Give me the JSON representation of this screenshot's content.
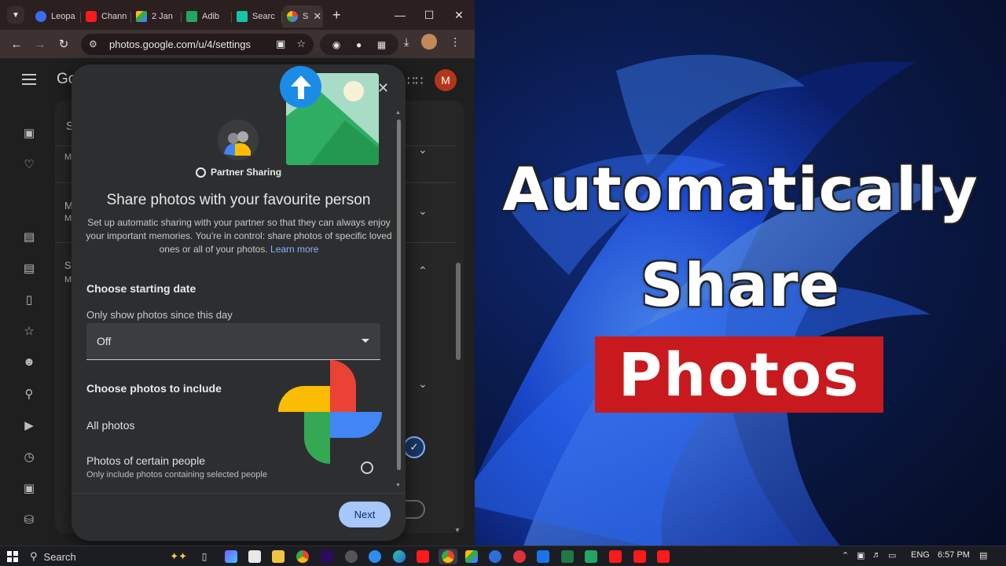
{
  "browser": {
    "tabs": [
      {
        "label": "Leopa",
        "color": "#3b6cf2"
      },
      {
        "label": "Chann",
        "color": "#ff1a1a"
      },
      {
        "label": "2 Jan",
        "color": "#34a853"
      },
      {
        "label": "Adib",
        "color": "#22a565"
      },
      {
        "label": "Searc",
        "color": "#19c3a6"
      },
      {
        "label": "S",
        "color": "#fbbc04"
      }
    ],
    "new_tab": "+",
    "url": "photos.google.com/u/4/settings"
  },
  "photos_page": {
    "logo_partial": "Goo",
    "avatar_letter": "M",
    "panel_letters": [
      "S",
      "M",
      "M",
      "M",
      "S",
      "M"
    ]
  },
  "dialog": {
    "badge": "Partner Sharing",
    "title": "Share photos with your favourite person",
    "description": "Set up automatic sharing with your partner so that they can always enjoy your important memories. You're in control: share photos of specific loved ones or all of your photos.",
    "learn_more": "Learn more",
    "starting_date": {
      "heading": "Choose starting date",
      "subheading": "Only show photos since this day",
      "selected": "Off"
    },
    "include": {
      "heading": "Choose photos to include",
      "option_all": "All photos",
      "option_people": "Photos of certain people",
      "option_people_sub": "Only include photos containing selected people"
    },
    "next_label": "Next"
  },
  "overlay": {
    "line1": "Automatically",
    "line2": "Share",
    "line3": "Photos"
  },
  "taskbar": {
    "search_label": "Search",
    "language": "ENG",
    "time": "6:57 PM"
  }
}
